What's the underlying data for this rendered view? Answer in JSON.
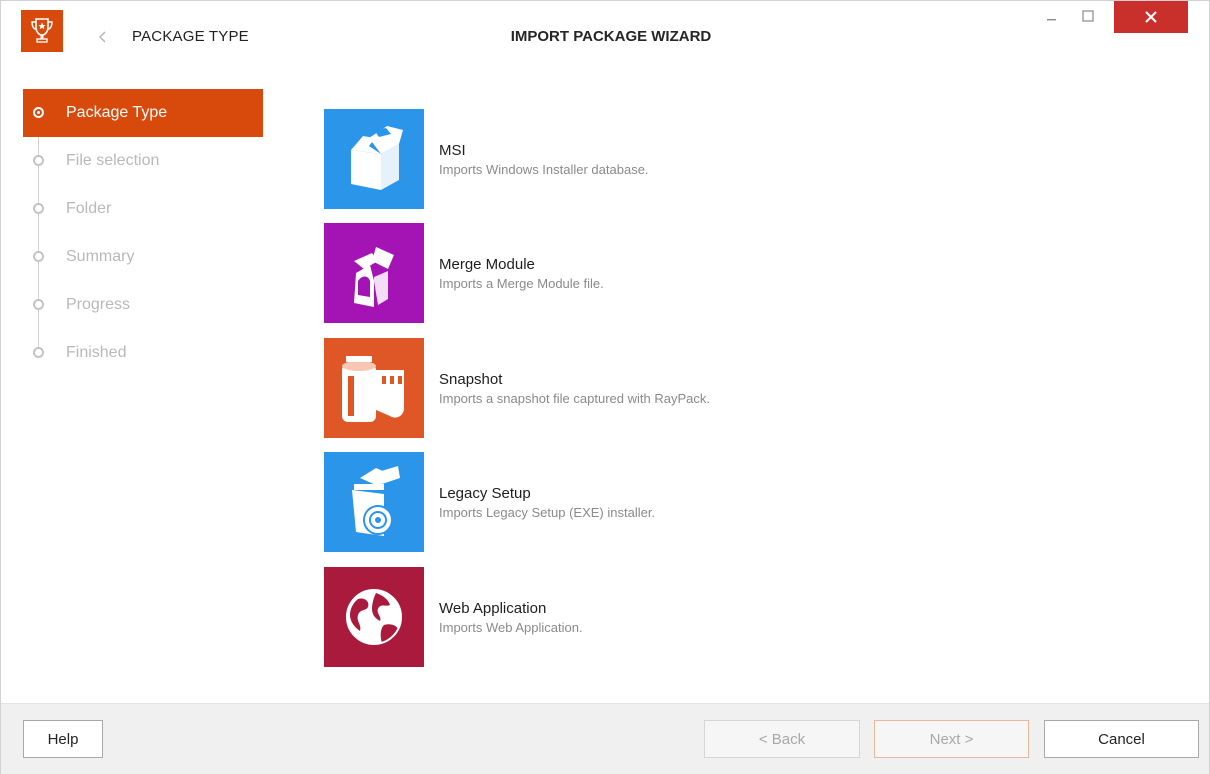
{
  "titlebar": {
    "page_heading": "PACKAGE TYPE",
    "wizard_title": "IMPORT PACKAGE WIZARD",
    "icons": {
      "logo": "trophy-icon",
      "back": "chevron-left-icon",
      "minimize": "minimize-icon",
      "maximize": "maximize-icon",
      "close": "close-icon"
    }
  },
  "steps": [
    {
      "label": "Package Type",
      "state": "active"
    },
    {
      "label": "File selection",
      "state": "pending"
    },
    {
      "label": "Folder",
      "state": "pending"
    },
    {
      "label": "Summary",
      "state": "pending"
    },
    {
      "label": "Progress",
      "state": "pending"
    },
    {
      "label": "Finished",
      "state": "pending"
    }
  ],
  "package_types": [
    {
      "name": "MSI",
      "description": "Imports Windows Installer database.",
      "color": "#2b95ea",
      "icon": "box-icon"
    },
    {
      "name": "Merge Module",
      "description": "Imports a Merge Module file.",
      "color": "#a414b4",
      "icon": "merge-module-icon"
    },
    {
      "name": "Snapshot",
      "description": "Imports a snapshot file captured with RayPack.",
      "color": "#df5727",
      "icon": "film-roll-icon"
    },
    {
      "name": "Legacy Setup",
      "description": "Imports Legacy Setup (EXE) installer.",
      "color": "#2b95ea",
      "icon": "setup-disc-icon"
    },
    {
      "name": "Web Application",
      "description": "Imports Web Application.",
      "color": "#a91a3d",
      "icon": "globe-icon"
    }
  ],
  "footer": {
    "help_label": "Help",
    "back_label": "< Back",
    "next_label": "Next >",
    "cancel_label": "Cancel"
  },
  "colors": {
    "accent": "#d84a0c",
    "close_button": "#c9302c",
    "step_inactive": "#b9b9b9"
  }
}
